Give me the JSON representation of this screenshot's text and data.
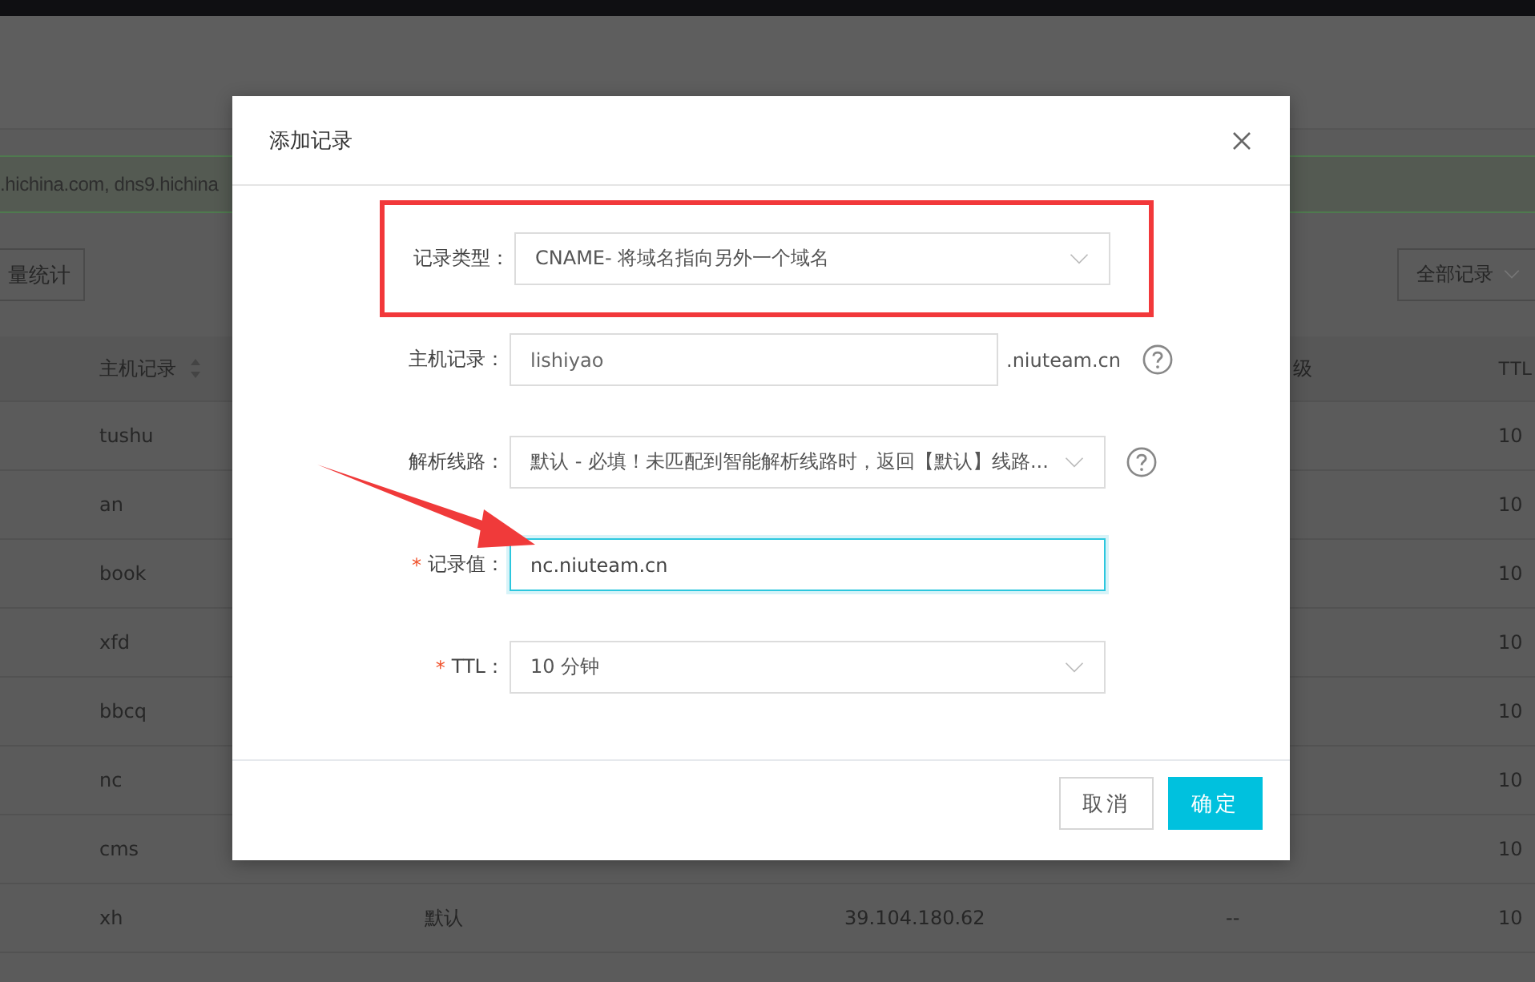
{
  "background_page": {
    "notice": ".hichina.com, dns9.hichina",
    "stats_button": "量统计",
    "filter_dropdown": "全部记录",
    "table": {
      "header": {
        "host": {
          "label": "主机记录",
          "sortable": true
        },
        "priority": {
          "label": "级"
        },
        "ttl": {
          "label": "TTL"
        }
      },
      "rows": [
        {
          "host": "tushu",
          "ttl": "10"
        },
        {
          "host": "an",
          "ttl": "10"
        },
        {
          "host": "book",
          "ttl": "10"
        },
        {
          "host": "xfd",
          "ttl": "10"
        },
        {
          "host": "bbcq",
          "ttl": "10"
        },
        {
          "host": "nc",
          "ttl": "10"
        },
        {
          "host": "cms",
          "ttl": "10"
        },
        {
          "host": "xh",
          "line": "默认",
          "value": "39.104.180.62",
          "priority": "--",
          "ttl": "10"
        }
      ]
    }
  },
  "dialog": {
    "title": "添加记录",
    "fields": [
      {
        "label": "记录类型：",
        "kind": "select",
        "value": "CNAME- 将域名指向另外一个域名",
        "highlighted": true,
        "help": false
      },
      {
        "label": "主机记录：",
        "kind": "input",
        "value": "lishiyao",
        "suffix": ".niuteam.cn",
        "highlighted": false,
        "help": true,
        "focused": false
      },
      {
        "label": "解析线路：",
        "kind": "select",
        "value": "默认 - 必填！未匹配到智能解析线路时，返回【默认】线路...",
        "highlighted": false,
        "help": true
      },
      {
        "label": "记录值：",
        "required_mark": "*",
        "kind": "input",
        "value": "nc.niuteam.cn",
        "highlighted": false,
        "help": false,
        "focused": true
      },
      {
        "label": "TTL：",
        "required_mark": "*",
        "kind": "select",
        "value": "10 分钟",
        "highlighted": false,
        "help": false
      }
    ],
    "buttons": [
      {
        "label": "取消",
        "primary": false
      },
      {
        "label": "确定",
        "primary": true
      }
    ]
  }
}
